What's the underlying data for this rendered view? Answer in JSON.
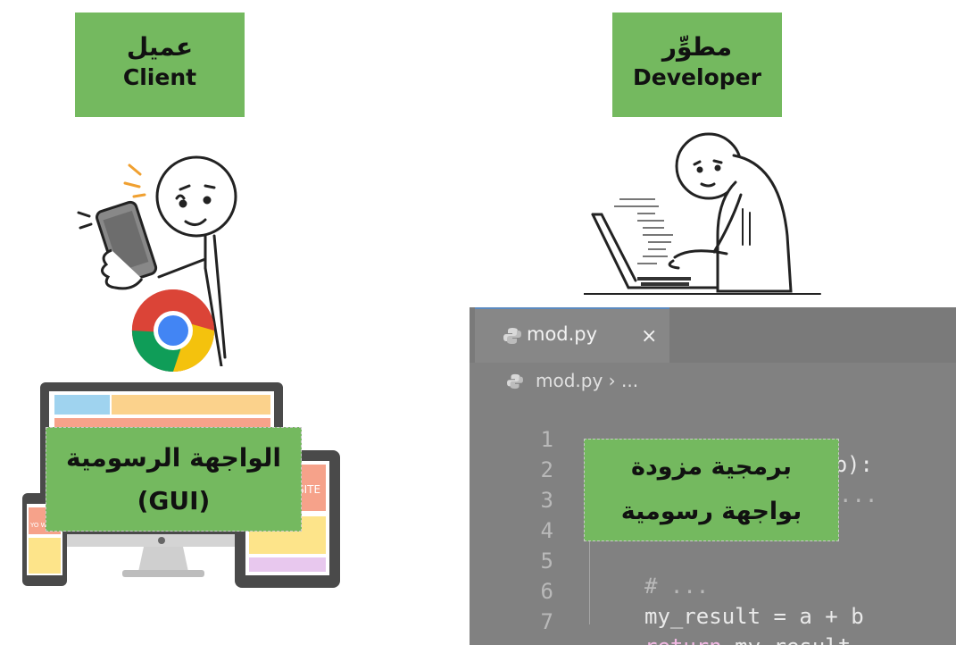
{
  "client": {
    "arabic": "عميل",
    "english": "Client"
  },
  "developer": {
    "arabic": "مطوِّر",
    "english": "Developer"
  },
  "gui_label": {
    "line1": "الواجهة الرسومية",
    "line2": "(GUI)"
  },
  "program_label": {
    "line1": "برمجية مزودة",
    "line2": "بواجهة رسومية"
  },
  "devices": {
    "monitor_text": "",
    "tablet_text": "SITE",
    "phone_text": "YO WEBS"
  },
  "editor": {
    "tab_name": "mod.py",
    "tab_close": "×",
    "breadcrumb": "mod.py › ...",
    "lines": [
      {
        "n": "1",
        "code": "def my_function(a, b):"
      },
      {
        "n": "2",
        "code": "..."
      },
      {
        "n": "3",
        "code": ""
      },
      {
        "n": "4",
        "code": ""
      },
      {
        "n": "5",
        "code": "# ..."
      },
      {
        "n": "6",
        "code": "my_result = a + b"
      },
      {
        "n": "7",
        "code": "return my_result"
      }
    ]
  },
  "colors": {
    "label_green": "#74b95f",
    "editor_bg": "#818181",
    "tab_accent": "#5b8ac0"
  }
}
